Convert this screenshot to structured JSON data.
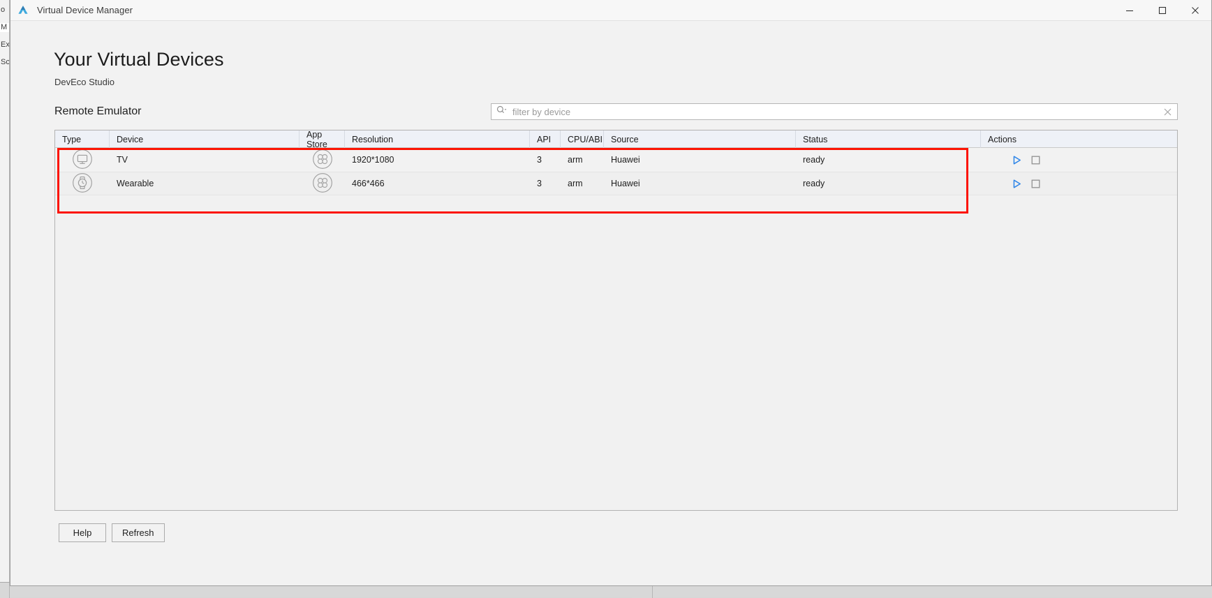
{
  "window": {
    "title": "Virtual Device Manager",
    "logo_icon": "deveco-triangle-logo-icon",
    "controls": {
      "minimize_label": "Minimize",
      "minimize_icon": "minimize-icon",
      "maximize_label": "Maximize",
      "maximize_icon": "maximize-icon",
      "close_label": "Close",
      "close_icon": "close-icon"
    }
  },
  "page": {
    "title": "Your Virtual Devices",
    "subtitle": "DevEco Studio",
    "section_title": "Remote Emulator"
  },
  "search": {
    "placeholder": "filter by device",
    "value": "",
    "icon": "search-icon",
    "dropdown_icon": "chevron-down-icon",
    "clear_icon": "clear-x-icon"
  },
  "table": {
    "columns": [
      {
        "key": "type",
        "label": "Type"
      },
      {
        "key": "device",
        "label": "Device"
      },
      {
        "key": "store",
        "label": "App Store"
      },
      {
        "key": "resolution",
        "label": "Resolution"
      },
      {
        "key": "api",
        "label": "API"
      },
      {
        "key": "cpu",
        "label": "CPU/ABI"
      },
      {
        "key": "source",
        "label": "Source"
      },
      {
        "key": "status",
        "label": "Status"
      },
      {
        "key": "actions",
        "label": "Actions"
      }
    ],
    "rows": [
      {
        "type_icon": "tv-monitor-icon",
        "device": "TV",
        "store_icon": "app-store-flower-icon",
        "resolution": "1920*1080",
        "api": "3",
        "cpu": "arm",
        "source": "Huawei",
        "status": "ready",
        "actions": {
          "run_icon": "play-run-icon",
          "stop_icon": "stop-square-icon"
        }
      },
      {
        "type_icon": "wearable-watch-icon",
        "device": "Wearable",
        "store_icon": "app-store-flower-icon",
        "resolution": "466*466",
        "api": "3",
        "cpu": "arm",
        "source": "Huawei",
        "status": "ready",
        "actions": {
          "run_icon": "play-run-icon",
          "stop_icon": "stop-square-icon"
        }
      }
    ]
  },
  "footer": {
    "help_label": "Help",
    "refresh_label": "Refresh"
  },
  "annotation": {
    "color": "#fc1405",
    "shape": "rectangle-highlight"
  },
  "background_window": {
    "visible_fragments": [
      "o",
      "M",
      "Ex",
      "Sc"
    ]
  }
}
